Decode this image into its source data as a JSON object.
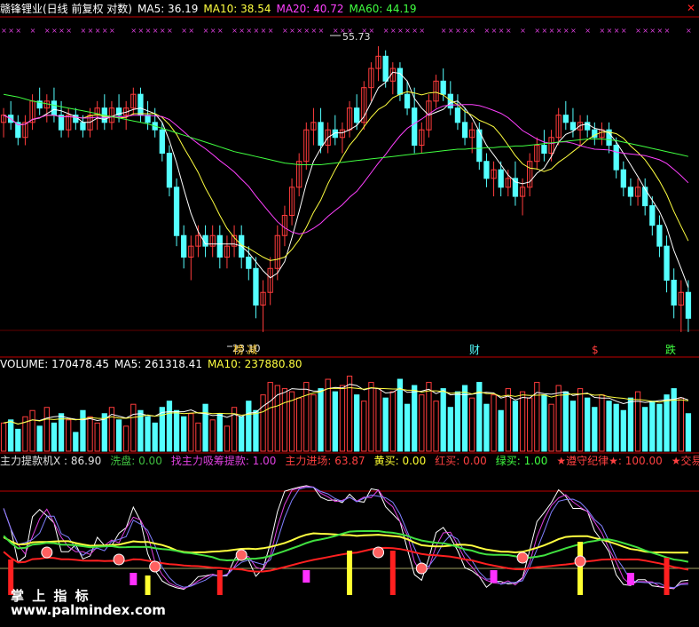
{
  "price_header": {
    "title": "赣锋锂业(日线 前复权 对数)",
    "ma5": "MA5: 36.19",
    "ma10": "MA10: 38.54",
    "ma20": "MA20: 40.72",
    "ma60": "MA60: 44.19"
  },
  "volume_header": {
    "title": "VOLUME: 170478.45",
    "ma5": "MA5: 261318.41",
    "ma10": "MA10: 237880.80"
  },
  "indicator_header": [
    {
      "text": "主力提款机X  : 86.90",
      "color": "#e0e0e0"
    },
    {
      "text": "洗盘: 0.00",
      "color": "#40c040"
    },
    {
      "text": "找主力吸筹提款: 1.00",
      "color": "#e040e0"
    },
    {
      "text": "主力进场: 63.87",
      "color": "#ff4040"
    },
    {
      "text": "黄买: 0.00",
      "color": "#ffff30"
    },
    {
      "text": "红买: 0.00",
      "color": "#ff4040"
    },
    {
      "text": "绿买: 1.00",
      "color": "#40ff40"
    },
    {
      "text": "★遵守纪律★: 100.00",
      "color": "#ff4040"
    },
    {
      "text": "★交易之",
      "color": "#ff4040"
    }
  ],
  "annotations": {
    "high": "55.73",
    "low": "23.10",
    "tag_bang": "榜",
    "tag_jian": "减",
    "tag_cai": "财",
    "tag_dollar": "$",
    "tag_die": "跌"
  },
  "watermark": {
    "line1": "掌 上 指 标",
    "line2": "www.palmindex.com"
  },
  "colors": {
    "up": "#ff3c3c",
    "down": "#54ffff",
    "ma5": "#ffffff",
    "ma10": "#ffff40",
    "ma20": "#ff40ff",
    "ma60": "#40ff40",
    "border": "#c00000"
  },
  "chart_data": [
    {
      "type": "candlestick",
      "scale": "log",
      "ylim": [
        22,
        60
      ],
      "ohlc": [
        [
          44,
          46,
          42,
          45
        ],
        [
          45,
          47,
          43,
          44
        ],
        [
          44,
          45,
          41,
          42
        ],
        [
          42,
          45,
          41,
          44
        ],
        [
          44,
          48,
          43,
          47
        ],
        [
          47,
          49,
          45,
          46
        ],
        [
          46,
          48,
          44,
          47
        ],
        [
          47,
          49,
          44,
          45
        ],
        [
          45,
          47,
          42,
          43
        ],
        [
          43,
          46,
          42,
          45
        ],
        [
          45,
          46,
          43,
          44
        ],
        [
          44,
          45,
          42,
          43
        ],
        [
          43,
          46,
          42,
          45
        ],
        [
          45,
          47,
          43,
          46
        ],
        [
          46,
          48,
          43,
          44
        ],
        [
          44,
          47,
          43,
          46
        ],
        [
          46,
          48,
          44,
          45
        ],
        [
          45,
          47,
          43,
          46
        ],
        [
          46,
          49,
          45,
          48
        ],
        [
          48,
          49,
          44,
          45
        ],
        [
          45,
          47,
          43,
          44
        ],
        [
          44,
          46,
          42,
          43
        ],
        [
          43,
          44,
          39,
          40
        ],
        [
          40,
          41,
          35,
          36
        ],
        [
          36,
          37,
          30,
          31
        ],
        [
          31,
          32,
          28,
          29
        ],
        [
          29,
          31,
          27,
          30
        ],
        [
          30,
          32,
          29,
          31
        ],
        [
          31,
          32,
          29,
          30
        ],
        [
          30,
          32,
          29,
          31
        ],
        [
          31,
          32,
          28,
          29
        ],
        [
          29,
          31,
          28,
          30
        ],
        [
          30,
          32,
          29,
          31
        ],
        [
          31,
          32,
          28,
          29
        ],
        [
          29,
          30,
          27,
          28
        ],
        [
          28,
          29,
          24,
          25
        ],
        [
          25,
          27,
          23,
          26
        ],
        [
          26,
          29,
          25,
          28
        ],
        [
          28,
          32,
          27,
          31
        ],
        [
          31,
          34,
          30,
          33
        ],
        [
          33,
          37,
          32,
          36
        ],
        [
          36,
          40,
          35,
          39
        ],
        [
          39,
          44,
          38,
          43
        ],
        [
          43,
          46,
          41,
          44
        ],
        [
          44,
          46,
          40,
          41
        ],
        [
          41,
          44,
          40,
          43
        ],
        [
          43,
          45,
          41,
          42
        ],
        [
          42,
          44,
          40,
          43
        ],
        [
          43,
          47,
          42,
          46
        ],
        [
          46,
          48,
          43,
          44
        ],
        [
          44,
          50,
          43,
          49
        ],
        [
          49,
          53,
          47,
          52
        ],
        [
          52,
          55.7,
          50,
          54
        ],
        [
          54,
          55,
          49,
          50
        ],
        [
          50,
          53,
          48,
          52
        ],
        [
          52,
          53,
          47,
          48
        ],
        [
          48,
          50,
          45,
          46
        ],
        [
          46,
          49,
          40,
          41
        ],
        [
          41,
          44,
          40,
          43
        ],
        [
          43,
          48,
          42,
          47
        ],
        [
          47,
          51,
          46,
          50
        ],
        [
          50,
          52,
          47,
          48
        ],
        [
          48,
          50,
          45,
          46
        ],
        [
          46,
          48,
          43,
          44
        ],
        [
          44,
          46,
          41,
          42
        ],
        [
          42,
          44,
          40,
          43
        ],
        [
          43,
          44,
          38,
          39
        ],
        [
          39,
          40,
          36,
          37
        ],
        [
          37,
          39,
          35,
          38
        ],
        [
          38,
          39,
          35,
          36
        ],
        [
          36,
          38,
          35,
          37
        ],
        [
          37,
          39,
          34,
          35
        ],
        [
          35,
          37,
          33,
          36
        ],
        [
          36,
          40,
          35,
          39
        ],
        [
          39,
          42,
          38,
          41
        ],
        [
          41,
          43,
          39,
          40
        ],
        [
          40,
          43,
          39,
          42
        ],
        [
          42,
          46,
          41,
          45
        ],
        [
          45,
          47,
          43,
          44
        ],
        [
          44,
          46,
          42,
          43
        ],
        [
          43,
          45,
          41,
          44
        ],
        [
          44,
          45,
          42,
          43
        ],
        [
          43,
          44,
          41,
          42
        ],
        [
          42,
          44,
          41,
          43
        ],
        [
          43,
          44,
          40,
          41
        ],
        [
          41,
          42,
          37,
          38
        ],
        [
          38,
          39,
          35,
          36
        ],
        [
          36,
          37,
          34,
          35
        ],
        [
          35,
          37,
          34,
          36
        ],
        [
          36,
          37,
          33,
          34
        ],
        [
          34,
          35,
          31,
          32
        ],
        [
          32,
          33,
          29,
          30
        ],
        [
          30,
          31,
          26,
          27
        ],
        [
          27,
          28,
          24,
          25
        ],
        [
          25,
          27,
          23,
          26
        ],
        [
          26,
          27,
          23,
          24
        ]
      ],
      "ma60": [
        48.0,
        47.8,
        47.6,
        47.3,
        47.0,
        46.8,
        46.6,
        46.4,
        46.2,
        46.0,
        45.8,
        45.6,
        45.4,
        45.2,
        45.0,
        44.8,
        44.6,
        44.4,
        44.2,
        44.0,
        43.8,
        43.5,
        43.2,
        42.9,
        42.6,
        42.3,
        42.0,
        41.7,
        41.4,
        41.1,
        40.8,
        40.5,
        40.2,
        40.0,
        39.8,
        39.6,
        39.4,
        39.2,
        39.0,
        38.8,
        38.7,
        38.6,
        38.6,
        38.6,
        38.6,
        38.7,
        38.8,
        38.9,
        39.0,
        39.1,
        39.2,
        39.3,
        39.4,
        39.5,
        39.6,
        39.7,
        39.8,
        39.9,
        40.0,
        40.1,
        40.2,
        40.3,
        40.4,
        40.5,
        40.5,
        40.6,
        40.6,
        40.7,
        40.7,
        40.8,
        40.8,
        40.9,
        40.9,
        41.0,
        41.1,
        41.2,
        41.3,
        41.4,
        41.5,
        41.6,
        41.7,
        41.8,
        41.8,
        41.8,
        41.7,
        41.6,
        41.4,
        41.2,
        41.0,
        40.8,
        40.6,
        40.4,
        40.2,
        40.0,
        39.8,
        39.6
      ]
    },
    {
      "type": "bar",
      "name": "VOLUME",
      "values": [
        9,
        10,
        7,
        11,
        13,
        8,
        14,
        9,
        12,
        10,
        6,
        13,
        11,
        9,
        12,
        14,
        10,
        8,
        15,
        13,
        11,
        9,
        14,
        16,
        13,
        11,
        12,
        9,
        15,
        10,
        12,
        8,
        14,
        11,
        16,
        13,
        18,
        22,
        21,
        20,
        19,
        17,
        22,
        18,
        20,
        23,
        19,
        21,
        24,
        18,
        16,
        22,
        20,
        17,
        19,
        23,
        15,
        21,
        18,
        22,
        16,
        20,
        14,
        19,
        21,
        17,
        22,
        15,
        18,
        13,
        20,
        16,
        19,
        17,
        22,
        18,
        15,
        21,
        19,
        16,
        20,
        17,
        14,
        18,
        16,
        15,
        13,
        17,
        19,
        14,
        16,
        15,
        18,
        20,
        17,
        12
      ],
      "ylim": [
        0,
        25
      ]
    }
  ]
}
